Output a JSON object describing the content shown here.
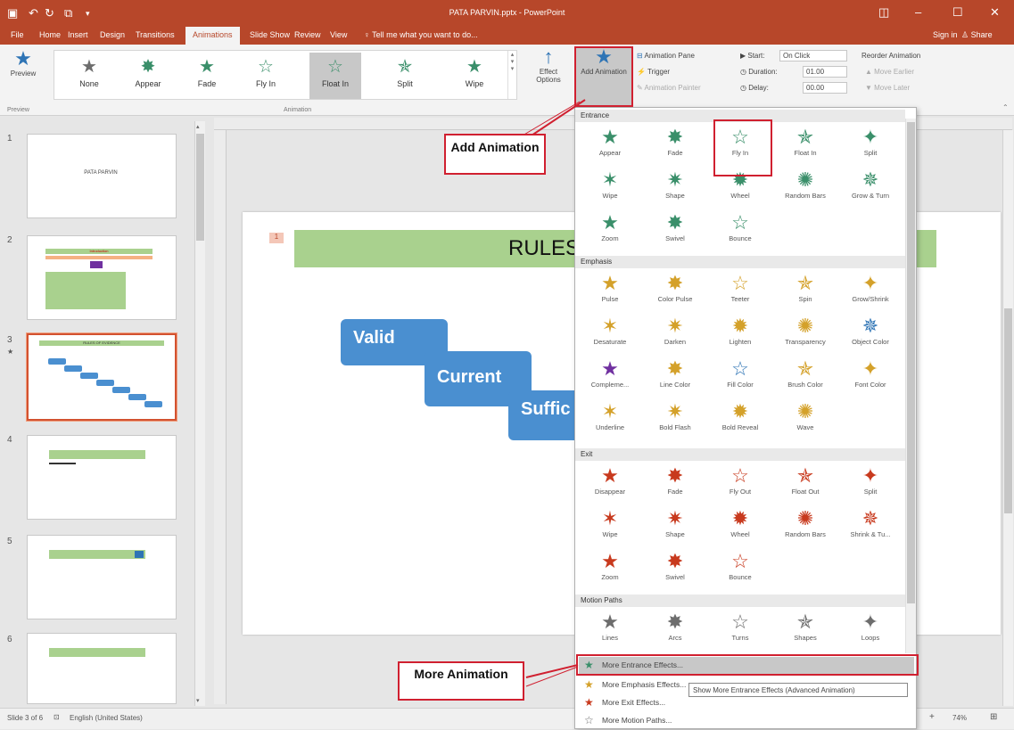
{
  "app": {
    "title": "PATA PARVIN.pptx - PowerPoint",
    "sign_in": "Sign in",
    "share": "Share",
    "tell_me": "Tell me what you want to do..."
  },
  "tabs": [
    "File",
    "Home",
    "Insert",
    "Design",
    "Transitions",
    "Animations",
    "Slide Show",
    "Review",
    "View"
  ],
  "ribbon": {
    "preview": "Preview",
    "preview_group": "Preview",
    "animation_group": "Animation",
    "gallery": [
      {
        "label": "None",
        "icon": "star-icon"
      },
      {
        "label": "Appear",
        "icon": "star-icon"
      },
      {
        "label": "Fade",
        "icon": "star-icon"
      },
      {
        "label": "Fly In",
        "icon": "star-icon"
      },
      {
        "label": "Float In",
        "icon": "star-icon"
      },
      {
        "label": "Split",
        "icon": "star-icon"
      },
      {
        "label": "Wipe",
        "icon": "star-icon"
      }
    ],
    "effect_options": "Effect Options",
    "add_animation": "Add Animation",
    "animation_pane": "Animation Pane",
    "trigger": "Trigger",
    "animation_painter": "Animation Painter",
    "start_label": "Start:",
    "start_value": "On Click",
    "duration_label": "Duration:",
    "duration_value": "01.00",
    "delay_label": "Delay:",
    "delay_value": "00.00",
    "reorder": "Reorder Animation",
    "move_earlier": "Move Earlier",
    "move_later": "Move Later"
  },
  "slides": [
    {
      "num": "1",
      "title": "PATA PARVIN"
    },
    {
      "num": "2",
      "title": "Introduction"
    },
    {
      "num": "3",
      "title": "RULES OF EVIDENCE"
    },
    {
      "num": "4",
      "title": ""
    },
    {
      "num": "5",
      "title": ""
    },
    {
      "num": "6",
      "title": ""
    }
  ],
  "main_slide": {
    "title": "RULES",
    "boxes": [
      "Valid",
      "Current",
      "Suffic"
    ]
  },
  "status": {
    "slide_count": "Slide 3 of 6",
    "language": "English (United States)",
    "zoom": "74%"
  },
  "dropdown": {
    "entrance": "Entrance",
    "entrance_items": [
      {
        "label": "Appear",
        "color": "gr"
      },
      {
        "label": "Fade",
        "color": "gr"
      },
      {
        "label": "Fly In",
        "color": "gr"
      },
      {
        "label": "Float In",
        "color": "gr"
      },
      {
        "label": "Split",
        "color": "gr"
      },
      {
        "label": "Wipe",
        "color": "gr"
      },
      {
        "label": "Shape",
        "color": "gr"
      },
      {
        "label": "Wheel",
        "color": "gr"
      },
      {
        "label": "Random Bars",
        "color": "gr"
      },
      {
        "label": "Grow & Turn",
        "color": "gr"
      },
      {
        "label": "Zoom",
        "color": "gr"
      },
      {
        "label": "Swivel",
        "color": "gr"
      },
      {
        "label": "Bounce",
        "color": "gr"
      }
    ],
    "emphasis": "Emphasis",
    "emphasis_items": [
      {
        "label": "Pulse",
        "color": "go"
      },
      {
        "label": "Color Pulse",
        "color": "go"
      },
      {
        "label": "Teeter",
        "color": "go"
      },
      {
        "label": "Spin",
        "color": "go"
      },
      {
        "label": "Grow/Shrink",
        "color": "go"
      },
      {
        "label": "Desaturate",
        "color": "go"
      },
      {
        "label": "Darken",
        "color": "go"
      },
      {
        "label": "Lighten",
        "color": "go"
      },
      {
        "label": "Transparency",
        "color": "go"
      },
      {
        "label": "Object Color",
        "color": "bl"
      },
      {
        "label": "Compleme...",
        "color": "pu"
      },
      {
        "label": "Line Color",
        "color": "go"
      },
      {
        "label": "Fill Color",
        "color": "bl"
      },
      {
        "label": "Brush Color",
        "color": "go"
      },
      {
        "label": "Font Color",
        "color": "go"
      },
      {
        "label": "Underline",
        "color": "go"
      },
      {
        "label": "Bold Flash",
        "color": "go"
      },
      {
        "label": "Bold Reveal",
        "color": "go"
      },
      {
        "label": "Wave",
        "color": "go"
      }
    ],
    "exit": "Exit",
    "exit_items": [
      {
        "label": "Disappear",
        "color": "rd"
      },
      {
        "label": "Fade",
        "color": "rd"
      },
      {
        "label": "Fly Out",
        "color": "rd"
      },
      {
        "label": "Float Out",
        "color": "rd"
      },
      {
        "label": "Split",
        "color": "rd"
      },
      {
        "label": "Wipe",
        "color": "rd"
      },
      {
        "label": "Shape",
        "color": "rd"
      },
      {
        "label": "Wheel",
        "color": "rd"
      },
      {
        "label": "Random Bars",
        "color": "rd"
      },
      {
        "label": "Shrink & Tu...",
        "color": "rd"
      },
      {
        "label": "Zoom",
        "color": "rd"
      },
      {
        "label": "Swivel",
        "color": "rd"
      },
      {
        "label": "Bounce",
        "color": "rd"
      }
    ],
    "motion": "Motion Paths",
    "motion_items": [
      {
        "label": "Lines",
        "color": "gy"
      },
      {
        "label": "Arcs",
        "color": "gy"
      },
      {
        "label": "Turns",
        "color": "gy"
      },
      {
        "label": "Shapes",
        "color": "gy"
      },
      {
        "label": "Loops",
        "color": "gy"
      }
    ],
    "more_entrance": "More Entrance Effects...",
    "more_emphasis": "More Emphasis Effects...",
    "more_exit": "More Exit Effects...",
    "more_motion": "More Motion Paths...",
    "tooltip": "Show More Entrance Effects (Advanced Animation)"
  },
  "callouts": {
    "add_animation": "Add Animation",
    "more_animation": "More Animation"
  },
  "colors": {
    "titlebar": "#b7472a",
    "accent_red": "#d02030",
    "slide_blue": "#4a8fd0",
    "slide_green": "#a9d18e"
  }
}
